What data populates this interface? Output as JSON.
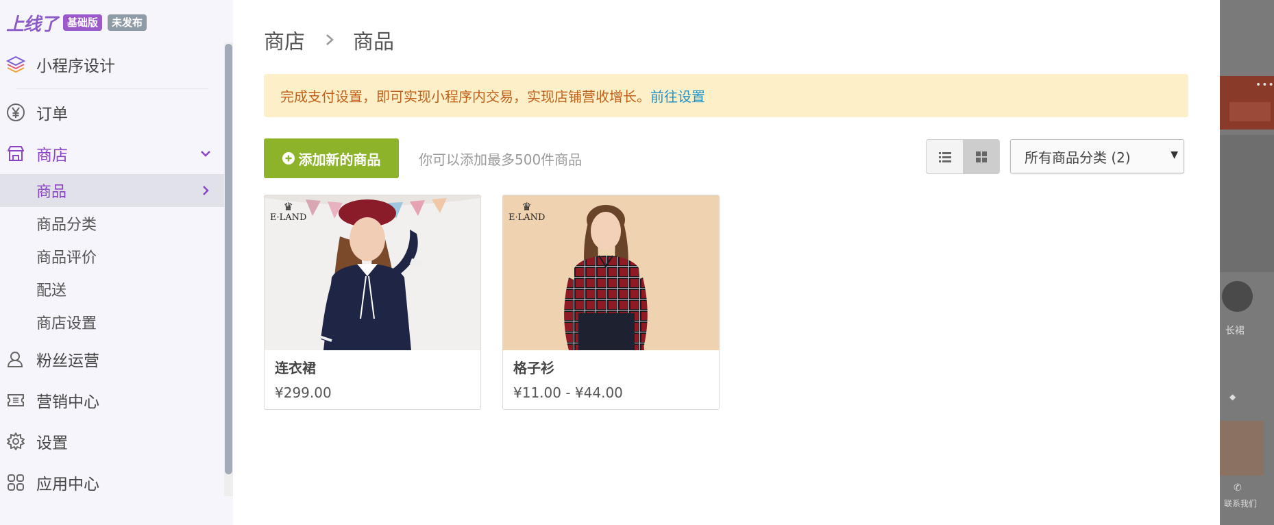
{
  "brand": {
    "logo_text": "上线了",
    "plan_badge": "基础版",
    "status_badge": "未发布"
  },
  "sidebar": {
    "items": [
      {
        "label": "小程序设计",
        "icon": "layers-icon"
      },
      {
        "label": "订单",
        "icon": "yen-circle-icon"
      },
      {
        "label": "商店",
        "icon": "store-icon",
        "expanded": true
      },
      {
        "label": "粉丝运营",
        "icon": "user-icon"
      },
      {
        "label": "营销中心",
        "icon": "ticket-icon"
      },
      {
        "label": "设置",
        "icon": "gear-icon"
      },
      {
        "label": "应用中心",
        "icon": "apps-icon"
      }
    ],
    "store_sub": [
      {
        "label": "商品",
        "active": true
      },
      {
        "label": "商品分类"
      },
      {
        "label": "商品评价"
      },
      {
        "label": "配送"
      },
      {
        "label": "商店设置"
      }
    ]
  },
  "breadcrumb": {
    "root": "商店",
    "current": "商品"
  },
  "notice": {
    "text": "完成支付设置，即可实现小程序内交易，实现店铺营收增长。",
    "link": "前往设置"
  },
  "toolbar": {
    "add_button": "添加新的商品",
    "hint": "你可以添加最多500件商品",
    "category_select": "所有商品分类 (2)",
    "view_mode": "grid"
  },
  "products": [
    {
      "name": "连衣裙",
      "price": "¥299.00",
      "brand_logo": "E·LAND"
    },
    {
      "name": "格子衫",
      "price": "¥11.00 - ¥44.00",
      "brand_logo": "E·LAND"
    }
  ],
  "preview": {
    "item_label": "长裙",
    "contact_label": "联系我们"
  },
  "colors": {
    "accent": "#8b44c6",
    "add_button": "#8db32a",
    "notice_bg": "#fdf0c8",
    "notice_text": "#c0601a",
    "link": "#1e90c8"
  }
}
